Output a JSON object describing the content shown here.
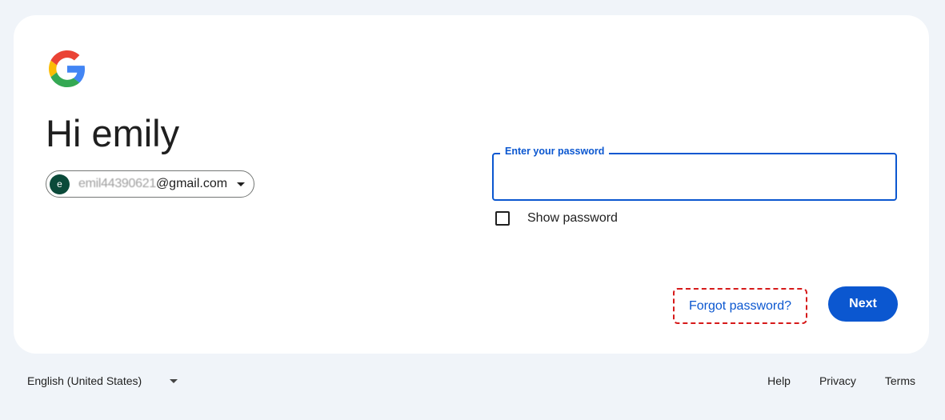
{
  "signin": {
    "greeting": "Hi emily",
    "account": {
      "avatar_letter": "e",
      "email_user": "emil44390621",
      "email_domain": "@gmail.com"
    },
    "password_field": {
      "label": "Enter your password",
      "value": ""
    },
    "show_password_label": "Show password",
    "show_password_checked": false,
    "forgot_password_label": "Forgot password?",
    "next_label": "Next"
  },
  "footer": {
    "language": "English (United States)",
    "links": [
      "Help",
      "Privacy",
      "Terms"
    ]
  },
  "colors": {
    "accent": "#0b57d0",
    "background": "#f0f4f9",
    "card": "#ffffff",
    "highlight_dashed": "#d61a1a",
    "avatar": "#0b4a3a"
  },
  "icons": {
    "logo": "google-g-logo",
    "chip_caret": "caret-down-icon",
    "lang_caret": "caret-down-icon"
  }
}
